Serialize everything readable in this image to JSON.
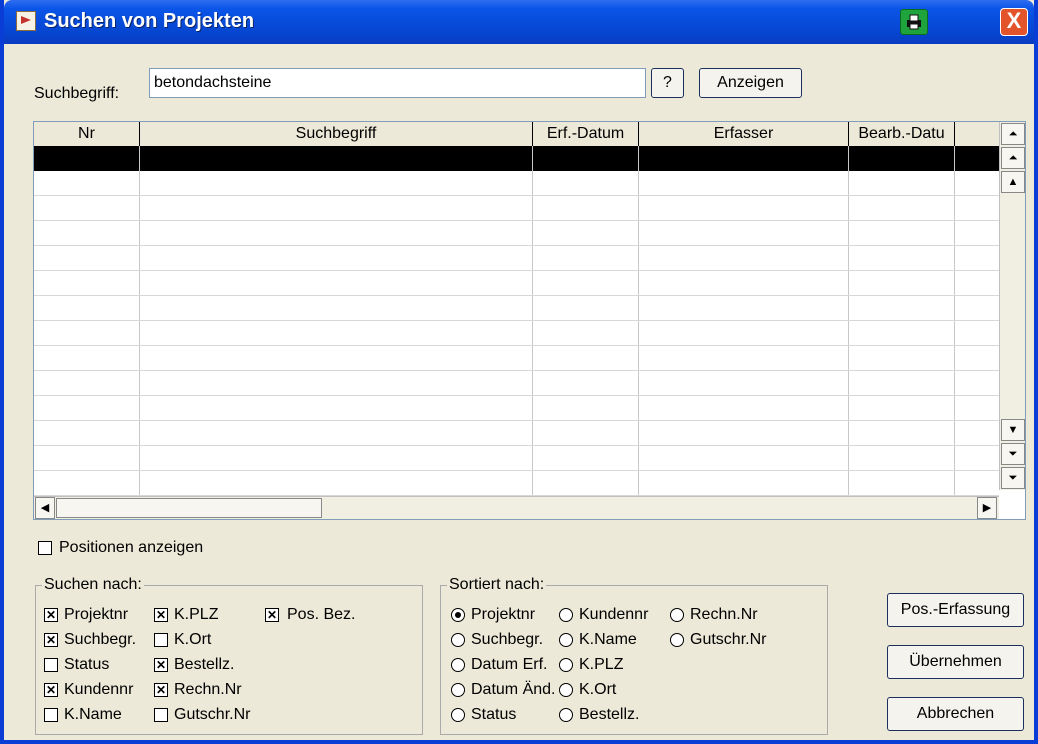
{
  "window": {
    "title": "Suchen von Projekten",
    "close_symbol": "X"
  },
  "search": {
    "label": "Suchbegriff:",
    "value": "betondachsteine",
    "help_label": "?",
    "show_label": "Anzeigen"
  },
  "grid": {
    "columns": [
      "Nr",
      "Suchbegriff",
      "Erf.-Datum",
      "Erfasser",
      "Bearb.-Datu"
    ],
    "scroll_up_symbols": [
      "⏶",
      "⏶",
      "▲"
    ],
    "scroll_down_symbols": [
      "▼",
      "⏷",
      "⏷"
    ],
    "hscroll_left": "◀",
    "hscroll_right": "▶"
  },
  "show_positions": {
    "label": "Positionen anzeigen",
    "checked": false
  },
  "search_by": {
    "title": "Suchen nach:",
    "col1": [
      {
        "label": "Projektnr",
        "checked": true
      },
      {
        "label": "Suchbegr.",
        "checked": true
      },
      {
        "label": "Status",
        "checked": false
      },
      {
        "label": "Kundennr",
        "checked": true
      },
      {
        "label": "K.Name",
        "checked": false
      }
    ],
    "col2": [
      {
        "label": "K.PLZ",
        "checked": true
      },
      {
        "label": "K.Ort",
        "checked": false
      },
      {
        "label": "Bestellz.",
        "checked": true
      },
      {
        "label": "Rechn.Nr",
        "checked": true
      },
      {
        "label": "Gutschr.Nr",
        "checked": false
      }
    ],
    "col3": [
      {
        "label": "Pos. Bez.",
        "checked": true
      }
    ]
  },
  "sorted_by": {
    "title": "Sortiert nach:",
    "col1": [
      {
        "label": "Projektnr",
        "selected": true
      },
      {
        "label": "Suchbegr.",
        "selected": false
      },
      {
        "label": "Datum Erf.",
        "selected": false
      },
      {
        "label": "Datum Änd.",
        "selected": false
      },
      {
        "label": "Status",
        "selected": false
      }
    ],
    "col2": [
      {
        "label": "Kundennr",
        "selected": false
      },
      {
        "label": "K.Name",
        "selected": false
      },
      {
        "label": "K.PLZ",
        "selected": false
      },
      {
        "label": "K.Ort",
        "selected": false
      },
      {
        "label": "Bestellz.",
        "selected": false
      }
    ],
    "col3": [
      {
        "label": "Rechn.Nr",
        "selected": false
      },
      {
        "label": "Gutschr.Nr",
        "selected": false
      }
    ]
  },
  "actions": {
    "pos_entry": "Pos.-Erfassung",
    "apply": "Übernehmen",
    "cancel": "Abbrechen"
  }
}
